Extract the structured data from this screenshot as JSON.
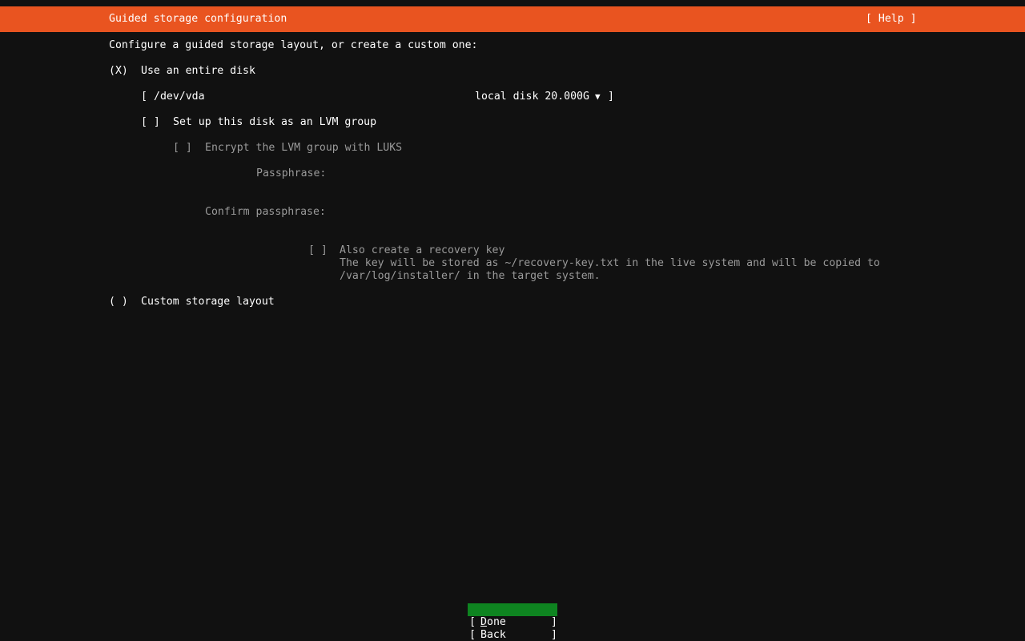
{
  "header": {
    "title": "Guided storage configuration",
    "help_label": "[ Help ]",
    "color": "#e95420"
  },
  "intro": "Configure a guided storage layout, or create a custom one:",
  "option_entire_disk": {
    "radio": "(X)",
    "label": "Use an entire disk",
    "selected": true
  },
  "disk_select": {
    "open_bracket": "[",
    "value": "/dev/vda",
    "detail": "local disk 20.000G",
    "arrow": "▼",
    "close_bracket": "]"
  },
  "lvm": {
    "checkbox": "[ ]",
    "label": "Set up this disk as an LVM group"
  },
  "luks": {
    "checkbox": "[ ]",
    "label": "Encrypt the LVM group with LUKS"
  },
  "passphrase": {
    "label": "Passphrase:",
    "value": ""
  },
  "confirm_passphrase": {
    "label": "Confirm passphrase:",
    "value": ""
  },
  "recovery": {
    "checkbox": "[ ]",
    "label": "Also create a recovery key",
    "desc_line1": "The key will be stored as ~/recovery-key.txt in the live system and will be copied to",
    "desc_line2": "/var/log/installer/ in the target system."
  },
  "option_custom": {
    "radio": "( )",
    "label": "Custom storage layout",
    "selected": false
  },
  "buttons": {
    "done": {
      "open": "[ ",
      "hotkey": "D",
      "rest": "one",
      "close": "]",
      "color": "#0e8420"
    },
    "back": {
      "open": "[ ",
      "label": "Back",
      "close": "]"
    }
  }
}
